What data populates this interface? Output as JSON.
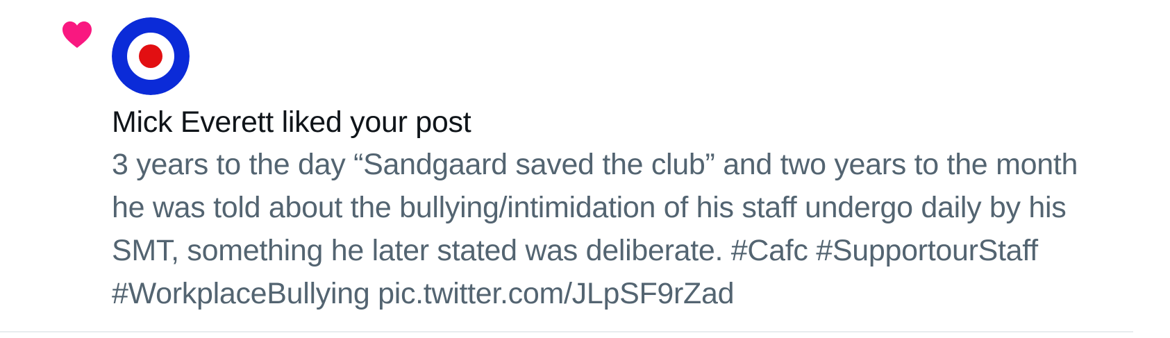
{
  "notification": {
    "icon": "heart-icon",
    "icon_color": "#f91880",
    "avatar": {
      "icon": "roundel-avatar-icon",
      "ring_colors": [
        "#0b2bd8",
        "#ffffff",
        "#e20f12"
      ]
    },
    "actor_name": "Mick Everett",
    "action_text": "liked your post",
    "headline": "Mick Everett liked your post",
    "post_lines": [
      "3 years to the day “Sandgaard saved the club” and two years to the month",
      "he was told about the bullying/intimidation of his staff undergo daily by his",
      "SMT, something he later stated was deliberate. #Cafc #SupportourStaff",
      "#WorkplaceBullying pic.twitter.com/JLpSF9rZad"
    ]
  },
  "colors": {
    "primary_text": "#0f1419",
    "secondary_text": "#536471",
    "divider": "#e8ecee",
    "like_pink": "#f91880"
  }
}
